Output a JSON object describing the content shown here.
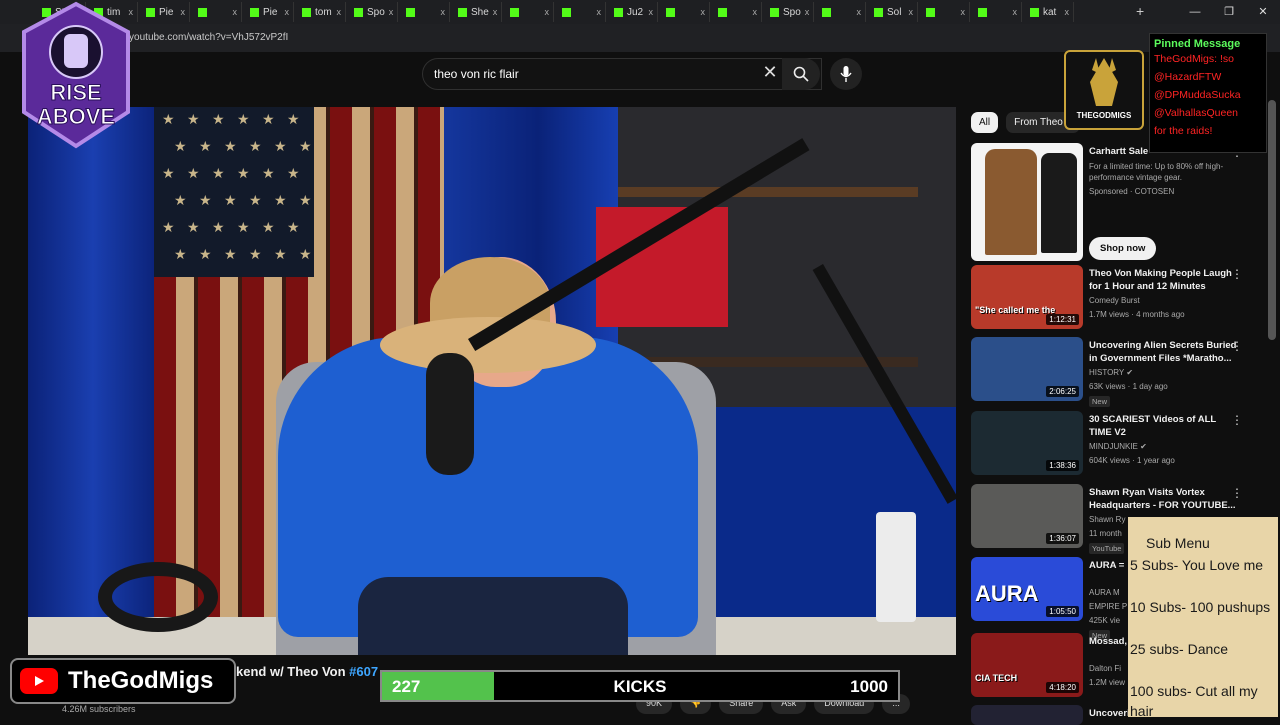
{
  "browser": {
    "tabs": [
      {
        "label": "Stre"
      },
      {
        "label": "tim"
      },
      {
        "label": "Pie"
      },
      {
        "label": ""
      },
      {
        "label": "Pie"
      },
      {
        "label": "tom"
      },
      {
        "label": "Spo"
      },
      {
        "label": ""
      },
      {
        "label": "She"
      },
      {
        "label": ""
      },
      {
        "label": ""
      },
      {
        "label": "Ju2"
      },
      {
        "label": ""
      },
      {
        "label": ""
      },
      {
        "label": "Spo"
      },
      {
        "label": ""
      },
      {
        "label": "Sol"
      },
      {
        "label": ""
      },
      {
        "label": ""
      },
      {
        "label": "kat"
      }
    ],
    "tab_close": "x",
    "new_tab": "+",
    "url": "v.youtube.com/watch?v=VhJ572vP2fI",
    "window_controls": {
      "minimize": "—",
      "maximize": "❐",
      "close": "✕"
    }
  },
  "youtube": {
    "search_value": "theo von ric flair",
    "search_clear": "✕",
    "video": {
      "title": "kend w/ Theo Von",
      "episode_tag": "#607",
      "subscribers": "4.26M subscribers",
      "actions": [
        "90K",
        "",
        "Share",
        "Ask",
        "Download",
        "..."
      ]
    },
    "chips": [
      {
        "label": "All",
        "active": true
      },
      {
        "label": "From Theo V",
        "active": false
      }
    ],
    "recommendations": [
      {
        "title": "Carhartt Sale",
        "desc": "For a limited time: Up to 80% off high-performance vintage gear.",
        "channel": "Sponsored · COTOSEN",
        "cta": "Shop now",
        "thumb_color": "#f4f4f4",
        "type": "ad"
      },
      {
        "title": "Theo Von Making People Laugh for 1 Hour and 12 Minutes",
        "channel": "Comedy Burst",
        "meta": "1.7M views · 4 months ago",
        "duration": "1:12:31",
        "thumb_color": "#b83a2a",
        "thumb_text": "\"She called me the"
      },
      {
        "title": "Uncovering Alien Secrets Buried in Government Files *Maratho...",
        "channel": "HISTORY ✔",
        "meta": "63K views · 1 day ago",
        "badge": "New",
        "duration": "2:06:25",
        "thumb_color": "#2b4f8a"
      },
      {
        "title": "30 SCARIEST Videos of ALL TIME V2",
        "channel": "MINDJUNKIE ✔",
        "meta": "604K views · 1 year ago",
        "duration": "1:38:36",
        "thumb_color": "#1c2a32"
      },
      {
        "title": "Shawn Ryan Visits Vortex Headquarters - FOR YOUTUBE...",
        "channel": "Shawn Ry",
        "meta": "11 month",
        "badge": "YouTube",
        "duration": "1:36:07",
        "thumb_color": "#5a5a58"
      },
      {
        "title": "AURA =",
        "channel": "AURA M",
        "meta": "EMPIRE P",
        "meta2": "425K vie",
        "badge": "New",
        "duration": "1:05:50",
        "thumb_color": "#2a4bd8",
        "thumb_text": "AURA"
      },
      {
        "title": "Mossad, Technol",
        "channel": "Dalton Fi",
        "meta": "1.2M view",
        "duration": "4:18:20",
        "thumb_color": "#8a1a1a",
        "thumb_text": "CIA TECH"
      },
      {
        "title": "Uncoveri",
        "thumb_color": "#223"
      }
    ]
  },
  "overlay": {
    "badge_text": [
      "RISE",
      "ABOVE"
    ],
    "streamer_logo": "THEGODMIGS",
    "pinned": {
      "header": "Pinned Message",
      "lines": [
        "TheGodMigs: !so",
        "@HazardFTW",
        "@DPMuddaSucka",
        "@ValhallasQueen",
        "for the raids!"
      ]
    },
    "sub_menu": {
      "title": "Sub Menu",
      "items": [
        "5 Subs- You Love me",
        "10 Subs- 100 pushups",
        "25 subs- Dance",
        "100 subs- Cut all my hair"
      ]
    },
    "brand_name": "TheGodMigs",
    "goal": {
      "current": "227",
      "label": "KICKS",
      "max": "1000",
      "fraction": 0.227,
      "fill_color": "#53c24c"
    }
  }
}
